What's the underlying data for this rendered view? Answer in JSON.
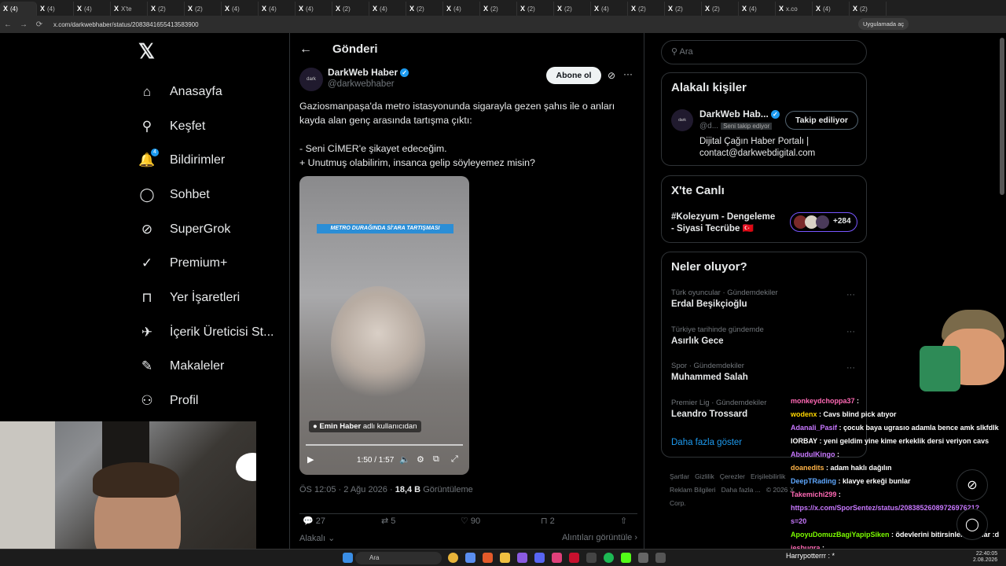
{
  "browser": {
    "tabs": [
      "(4)",
      "(4)",
      "(4)",
      "X'te",
      "(2)",
      "(2)",
      "(4)",
      "(4)",
      "(4)",
      "(2)",
      "(4)",
      "(2)",
      "(4)",
      "(2)",
      "(2)",
      "(2)",
      "(4)",
      "(2)",
      "(2)",
      "(2)",
      "(4)",
      "x.co",
      "(4)",
      "(2)"
    ],
    "url": "x.com/darkwebhaber/status/2083841655413583900",
    "app_badge": "Uygulamada aç"
  },
  "nav": {
    "logo": "𝕏",
    "items": [
      {
        "label": "Anasayfa",
        "icon": "home-icon",
        "glyph": "⌂"
      },
      {
        "label": "Keşfet",
        "icon": "search-icon",
        "glyph": "⚲"
      },
      {
        "label": "Bildirimler",
        "icon": "bell-icon",
        "glyph": "🔔",
        "badge": "4"
      },
      {
        "label": "Sohbet",
        "icon": "chat-icon",
        "glyph": "◯"
      },
      {
        "label": "SuperGrok",
        "icon": "grok-icon",
        "glyph": "⊘"
      },
      {
        "label": "Premium+",
        "icon": "premium-icon",
        "glyph": "✓"
      },
      {
        "label": "Yer İşaretleri",
        "icon": "bookmark-icon",
        "glyph": "⊓"
      },
      {
        "label": "İçerik Üreticisi St...",
        "icon": "rocket-icon",
        "glyph": "✈"
      },
      {
        "label": "Makaleler",
        "icon": "article-icon",
        "glyph": "✎"
      },
      {
        "label": "Profil",
        "icon": "profile-icon",
        "glyph": "⚇"
      }
    ]
  },
  "post": {
    "header": "Gönderi",
    "author_name": "DarkWeb Haber",
    "author_handle": "@darkwebhaber",
    "follow_label": "Abone ol",
    "text": "Gaziosmanpaşa'da metro istasyonunda sigarayla gezen şahıs ile o anları\nkayda alan genç arasında tartışma çıktı:\n\n- Seni CİMER'e şikayet edeceğim.\n+ Unutmuş olabilirim, insanca gelip söyleyemez misin?",
    "media": {
      "caption": "METRO DURAĞINDA Sİ'ARA TARTIŞMASI",
      "source_name": "Emin Haber",
      "source_suffix": "adlı kullanıcıdan",
      "time": "1:50 / 1:57"
    },
    "meta_time": "ÖS 12:05 · 2 Ağu 2026 · ",
    "views": "18,4 B",
    "views_label": "Görüntüleme",
    "replies": "27",
    "reposts": "5",
    "likes": "90",
    "bookmarks": "2",
    "relevant": "Alakalı",
    "quotes_link": "Alıntıları görüntüle"
  },
  "sidebar": {
    "search_placeholder": "Ara",
    "related_title": "Alakalı kişiler",
    "related": {
      "name": "DarkWeb Hab...",
      "handle": "@d...",
      "follows_you": "Seni takip ediyor",
      "button": "Takip ediliyor",
      "bio": "Dijital Çağın Haber Portalı |\ncontact@darkwebdigital.com"
    },
    "live_title": "X'te Canlı",
    "live_text": "#Kolezyum - Dengeleme\n- Siyasi Tecrübe 🇹🇷",
    "live_count": "+284",
    "trends_title": "Neler oluyor?",
    "trends": [
      {
        "category": "Türk oyuncular · Gündemdekiler",
        "name": "Erdal Beşikçioğlu"
      },
      {
        "category": "Türkiye tarihinde gündemde",
        "name": "Asırlık Gece"
      },
      {
        "category": "Spor · Gündemdekiler",
        "name": "Muhammed Salah"
      },
      {
        "category": "Premier Lig · Gündemdekiler",
        "name": "Leandro Trossard"
      }
    ],
    "show_more": "Daha fazla göster",
    "footer": [
      "Şartlar",
      "Gizlilik",
      "Çerezler",
      "Erişilebilirlik",
      "Reklam Bilgileri",
      "Daha fazla ...",
      "© 2026 X Corp."
    ]
  },
  "chat": [
    {
      "user": "monkeydchoppa37",
      "color": "#ff69b4",
      "msg": ""
    },
    {
      "user": "wodenx",
      "color": "#ffd700",
      "msg": "Cavs blind pick atıyor"
    },
    {
      "user": "Adanali_Pasif",
      "color": "#c878ff",
      "msg": "çocuk baya ugrasıo adamla bence amk slkfdlk"
    },
    {
      "user": "IORBAY",
      "color": "#ffffff",
      "msg": "yeni geldim yine kime erkeklik dersi veriyon cavs"
    },
    {
      "user": "AbudulKingo",
      "color": "#c878ff",
      "msg": ""
    },
    {
      "user": "doanedits",
      "color": "#ffb347",
      "msg": "adam haklı dağılın"
    },
    {
      "user": "DeepTRading",
      "color": "#5fa8ff",
      "msg": "klavye erkeği bunlar"
    },
    {
      "user": "Takemichi299",
      "color": "#ff69b4",
      "msg": ""
    },
    {
      "user": "",
      "color": "#c878ff",
      "msg": "https://x.com/SporSentez/status/2083852608972697621?"
    },
    {
      "user": "",
      "color": "#c878ff",
      "msg": "s=20"
    },
    {
      "user": "ApoyuDomuzBagiYapipSiken",
      "color": "#7cfc00",
      "msg": "ödevlerini bitirsinler çıkarlar :d"
    },
    {
      "user": "jesbugra",
      "color": "#ff69b4",
      "msg": ""
    }
  ],
  "taskbar": {
    "search": "Ara",
    "media": "Harrypotterrr : *",
    "time": "22:40:05",
    "date": "2.08.2026"
  }
}
